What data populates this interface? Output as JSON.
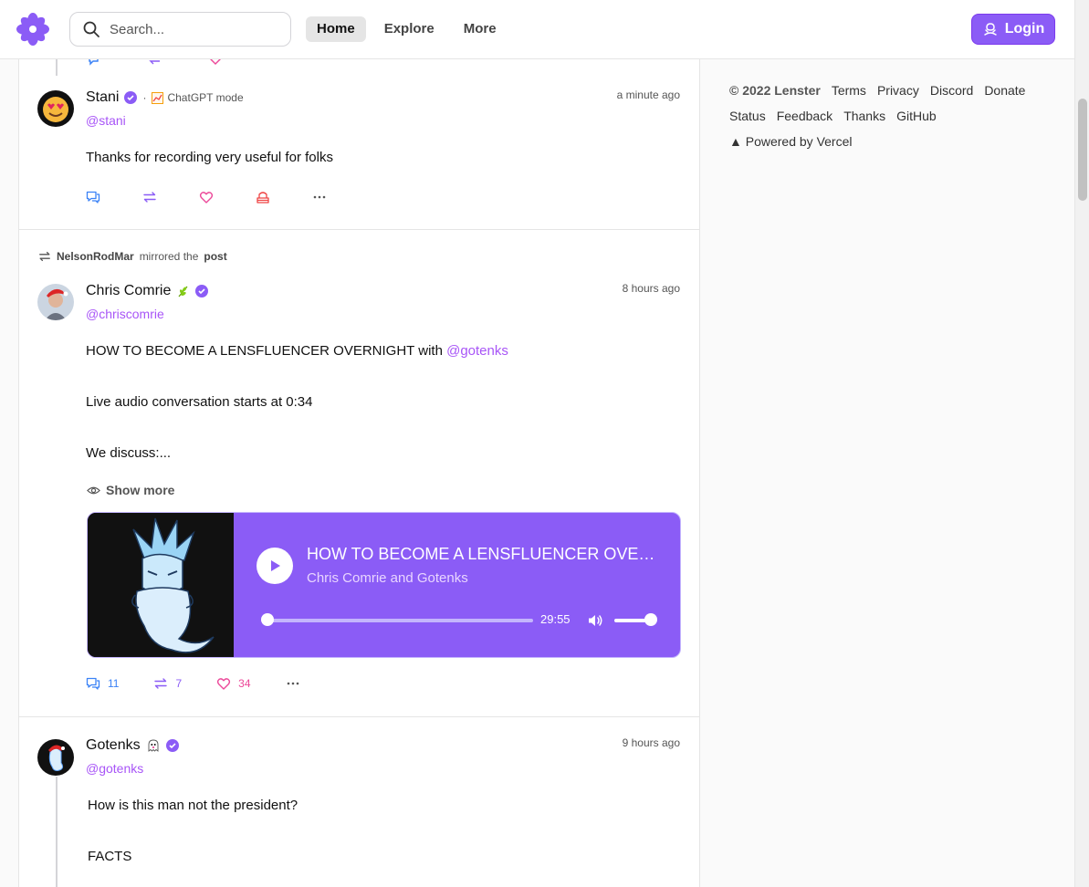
{
  "header": {
    "search_placeholder": "Search...",
    "nav": [
      "Home",
      "Explore",
      "More"
    ],
    "active_nav": "Home",
    "login_label": "Login"
  },
  "posts": [
    {
      "author": "Stani",
      "handle": "@stani",
      "badge_label": "ChatGPT mode",
      "time": "a minute ago",
      "text": "Thanks for recording very useful for folks",
      "verified": true
    },
    {
      "mirrored_by": "NelsonRodMar",
      "mirror_text": "mirrored the",
      "mirror_target": "post",
      "author": "Chris Comrie",
      "handle": "@chriscomrie",
      "time": "8 hours ago",
      "text_line1_prefix": "HOW TO BECOME A LENSFLUENCER OVERNIGHT with ",
      "text_line1_mention": "@gotenks",
      "text_line2": "Live audio conversation starts at 0:34",
      "text_line3": "We discuss:...",
      "show_more": "Show more",
      "audio": {
        "title": "HOW TO BECOME A LENSFLUENCER OVERNIGHT with @gotenks",
        "subtitle": "Chris Comrie and Gotenks",
        "duration": "29:55",
        "progress": 0,
        "volume": 1
      },
      "stats": {
        "comments": "11",
        "mirrors": "7",
        "likes": "34"
      },
      "verified": true
    },
    {
      "author": "Gotenks",
      "handle": "@gotenks",
      "time": "9 hours ago",
      "text_line1": "How is this man not the president?",
      "text_line2": "FACTS",
      "verified": true
    }
  ],
  "sidebar": {
    "copyright": "© 2022 Lenster",
    "links": [
      "Terms",
      "Privacy",
      "Discord",
      "Donate",
      "Status",
      "Feedback",
      "Thanks",
      "GitHub"
    ],
    "powered_by": "▲ Powered by Vercel"
  },
  "colors": {
    "brand": "#8b5cf6",
    "accent_purple": "#a855f7",
    "comment_blue": "#3b82f6",
    "mirror_purple": "#8b5cf6",
    "like_pink": "#ec4899",
    "collect_red": "#ef4444"
  }
}
